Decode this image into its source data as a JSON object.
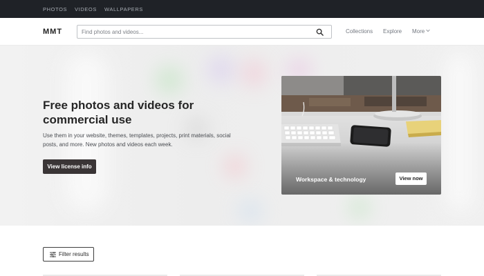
{
  "topnav": {
    "items": [
      "PHOTOS",
      "VIDEOS",
      "WALLPAPERS"
    ]
  },
  "header": {
    "logo": "MMT",
    "search_placeholder": "Find photos and videos...",
    "links": [
      "Collections",
      "Explore",
      "More"
    ]
  },
  "hero": {
    "title": "Free photos and videos for commercial use",
    "description": "Use them in your website, themes, templates, projects, print materials, social posts, and more. New photos and videos each week.",
    "cta_label": "View license info"
  },
  "featured": {
    "label": "Workspace & technology",
    "button_label": "View now"
  },
  "filter": {
    "label": "Filter results"
  },
  "colors": {
    "topbar": "#1f2227",
    "cta": "#3a3536",
    "accent_text": "#262626"
  }
}
